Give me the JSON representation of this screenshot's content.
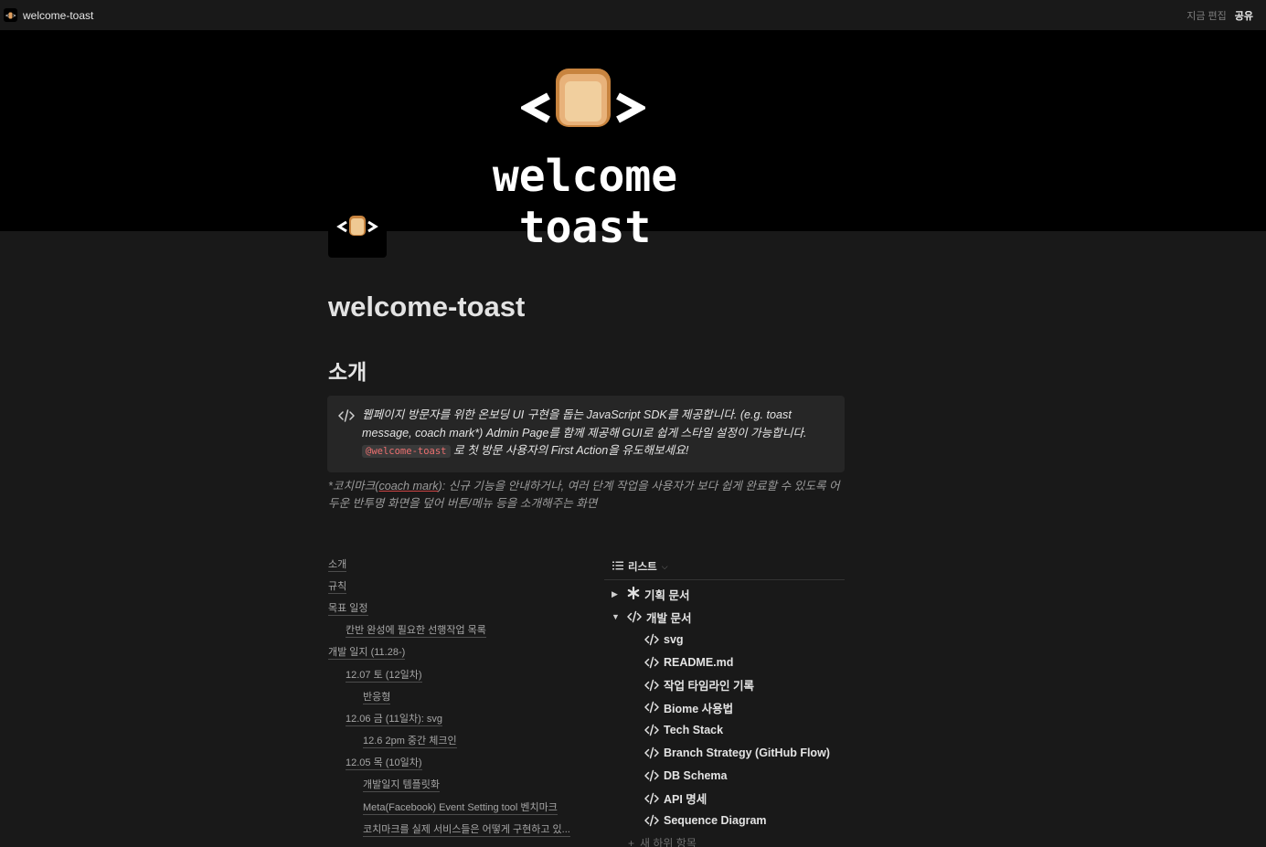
{
  "topbar": {
    "title": "welcome-toast",
    "edited": "지금 편집",
    "share": "공유"
  },
  "cover": {
    "title": "welcome toast",
    "icon": "code-bread-logo"
  },
  "page": {
    "title": "welcome-toast",
    "section_heading": "소개"
  },
  "callout": {
    "icon": "code-icon",
    "text_1": "웹페이지 방문자를 위한 온보딩 UI 구현을 돕는 JavaScript SDK를 제공합니다. (e.g. toast message, coach mark*) Admin Page를 함께 제공해 GUI로 쉽게 스타일 설정이 가능합니다.",
    "code": "@welcome-toast",
    "text_2": " 로 첫 방문 사용자의 First Action을 유도해보세요!"
  },
  "note": {
    "prefix": "*코치마크(",
    "term": "coach mark",
    "suffix": "): 신규 기능을 안내하거나, 여러 단계 작업을 사용자가 보다 쉽게 완료할 수 있도록 어두운 반투명 화면을 덮어 버튼/메뉴 등을 소개해주는 화면"
  },
  "toc": [
    {
      "label": "소개",
      "level": 0
    },
    {
      "label": "규칙",
      "level": 0
    },
    {
      "label": "목표 일정",
      "level": 0
    },
    {
      "label": "칸반 완성에 필요한 선행작업 목록",
      "level": 1
    },
    {
      "label": "개발 일지 (11.28-)",
      "level": 0
    },
    {
      "label": "12.07 토 (12일차)",
      "level": 1
    },
    {
      "label": "반응형",
      "level": 2
    },
    {
      "label": "12.06 금 (11일차): svg",
      "level": 1
    },
    {
      "label": "12.6 2pm 중간 체크인",
      "level": 2
    },
    {
      "label": "12.05 목 (10일차)",
      "level": 1
    },
    {
      "label": "개발일지 템플릿화",
      "level": 2
    },
    {
      "label": "Meta(Facebook) Event Setting tool 벤치마크",
      "level": 2
    },
    {
      "label": "코치마크를 실제 서비스들은 어떻게 구현하고 있...",
      "level": 2
    }
  ],
  "database": {
    "view_label": "리스트",
    "view_icon": "list-icon",
    "groups": [
      {
        "label": "기획 문서",
        "expanded": false,
        "icon": "asterisk-icon"
      },
      {
        "label": "개발 문서",
        "expanded": true,
        "icon": "code-icon"
      }
    ],
    "children": [
      "svg",
      "README.md",
      "작업 타임라인 기록",
      "Biome 사용법",
      "Tech Stack",
      "Branch Strategy (GitHub Flow)",
      "DB Schema",
      "API 명세",
      "Sequence Diagram"
    ],
    "new_item": "새 하위 항목"
  },
  "colors": {
    "background": "#191919",
    "cover": "#000000",
    "callout_bg": "#262626",
    "inline_code": "#eb6f6f"
  }
}
